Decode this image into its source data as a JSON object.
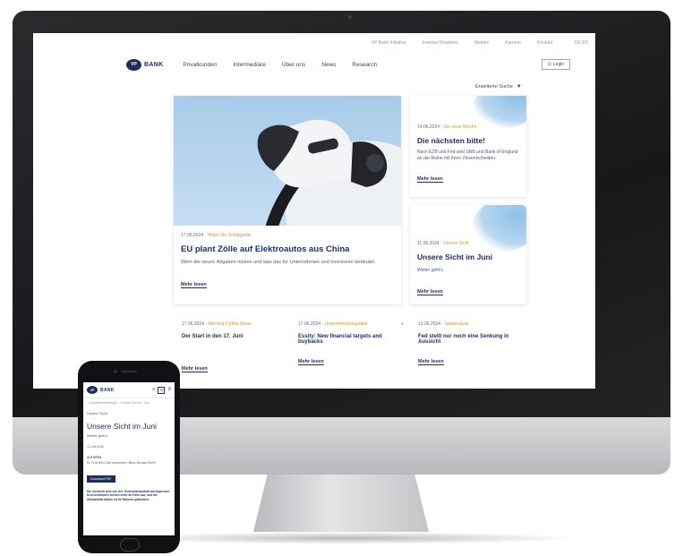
{
  "desktop": {
    "utility_links": [
      "VP Bank Initiative",
      "Investor Relations",
      "Medien",
      "Karriere",
      "Kontakt"
    ],
    "language": "DE  EN",
    "logo_badge": "VP",
    "logo_text": "BANK",
    "nav": [
      "Privatkunden",
      "Intermediäre",
      "Über uns",
      "News",
      "Research"
    ],
    "login_label": "Login",
    "extended_search": "Erweiterte Suche",
    "hero": {
      "date": "17.06.2024",
      "tag": "Hinter der Schlagzeile",
      "title": "EU plant Zölle auf Elektroautos aus China",
      "text": "Wem die neuen Abgaben nützen und was das für Unternehmen und Investoren bedeutet.",
      "more": "Mehr lesen"
    },
    "side1": {
      "date": "14.06.2024",
      "tag": "Die neue Woche",
      "title": "Die nächsten bitte!",
      "text": "Nach EZB und Fed sind SNB und Bank of England an der Reihe mit ihren Zinsentscheiden.",
      "more": "Mehr lesen"
    },
    "side2": {
      "date": "11.06.2024",
      "tag": "Unsere Sicht",
      "title": "Unsere Sicht im Juni",
      "text": "Weiter geht's.",
      "more": "Mehr lesen"
    },
    "row": [
      {
        "date": "17.06.2024",
        "tag": "Morning Coffee News",
        "title": "Der Start in den 17. Juni",
        "more": "Mehr lesen"
      },
      {
        "date": "17.06.2024",
        "tag": "Unternehmensupdate",
        "title": "Essity: New financial targets and buybacks",
        "more": "Mehr lesen"
      },
      {
        "date": "13.06.2024",
        "tag": "Spotanalyse",
        "title": "Fed stellt nur noch eine Senkung in Aussicht",
        "more": "Mehr lesen"
      }
    ]
  },
  "mobile": {
    "logo_badge": "VP",
    "logo_text": "BANK",
    "breadcrumb": "< Investmentstrategie > Unsere Sicht im Juni",
    "section": "Unsere Sicht",
    "title": "Unsere Sicht im Juni",
    "subtitle": "Weiter geht's.",
    "date": "11.Juni 2024",
    "author_label": "AUTOREN",
    "authors": "Dr. Felix Brill  Chief Investment Officer  Bernard Eberli",
    "download": "Download PDF",
    "body": "Die Zuckerln sind von der Themenlandschaft durchgesetzt. KI-Investitionen drehen mehr an Fahrt auf, und die Attraktivität Aktien ist im Rahmen geblieben."
  }
}
